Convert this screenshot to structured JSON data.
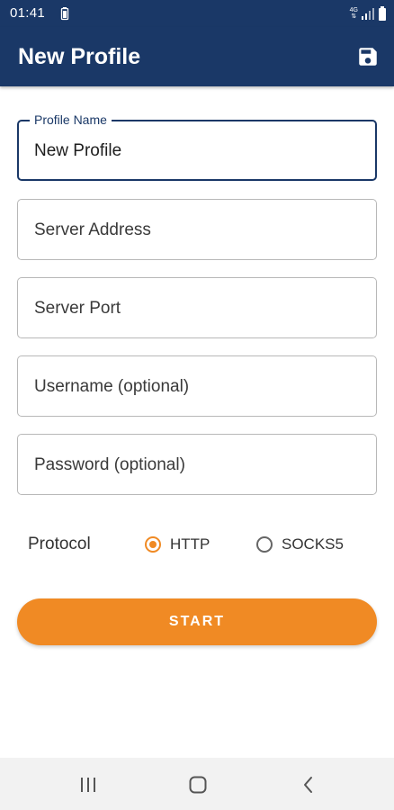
{
  "status_bar": {
    "time": "01:41",
    "network_type_top": "4G",
    "network_type_bottom": "⇅"
  },
  "app_bar": {
    "title": "New Profile",
    "save_icon": "save-icon"
  },
  "form": {
    "profile_name": {
      "label": "Profile Name",
      "value": "New Profile"
    },
    "server_address": {
      "placeholder": "Server Address"
    },
    "server_port": {
      "placeholder": "Server Port"
    },
    "username": {
      "placeholder": "Username (optional)"
    },
    "password": {
      "placeholder": "Password (optional)"
    }
  },
  "protocol": {
    "label": "Protocol",
    "options": [
      {
        "label": "HTTP",
        "selected": true
      },
      {
        "label": "SOCKS5",
        "selected": false
      }
    ]
  },
  "start_button": {
    "label": "START"
  },
  "colors": {
    "primary": "#1a3867",
    "accent": "#f08a24",
    "nav_background": "#f2f2f2"
  },
  "nav_bar": {
    "icons": [
      "recent-apps-icon",
      "home-icon",
      "back-icon"
    ]
  }
}
